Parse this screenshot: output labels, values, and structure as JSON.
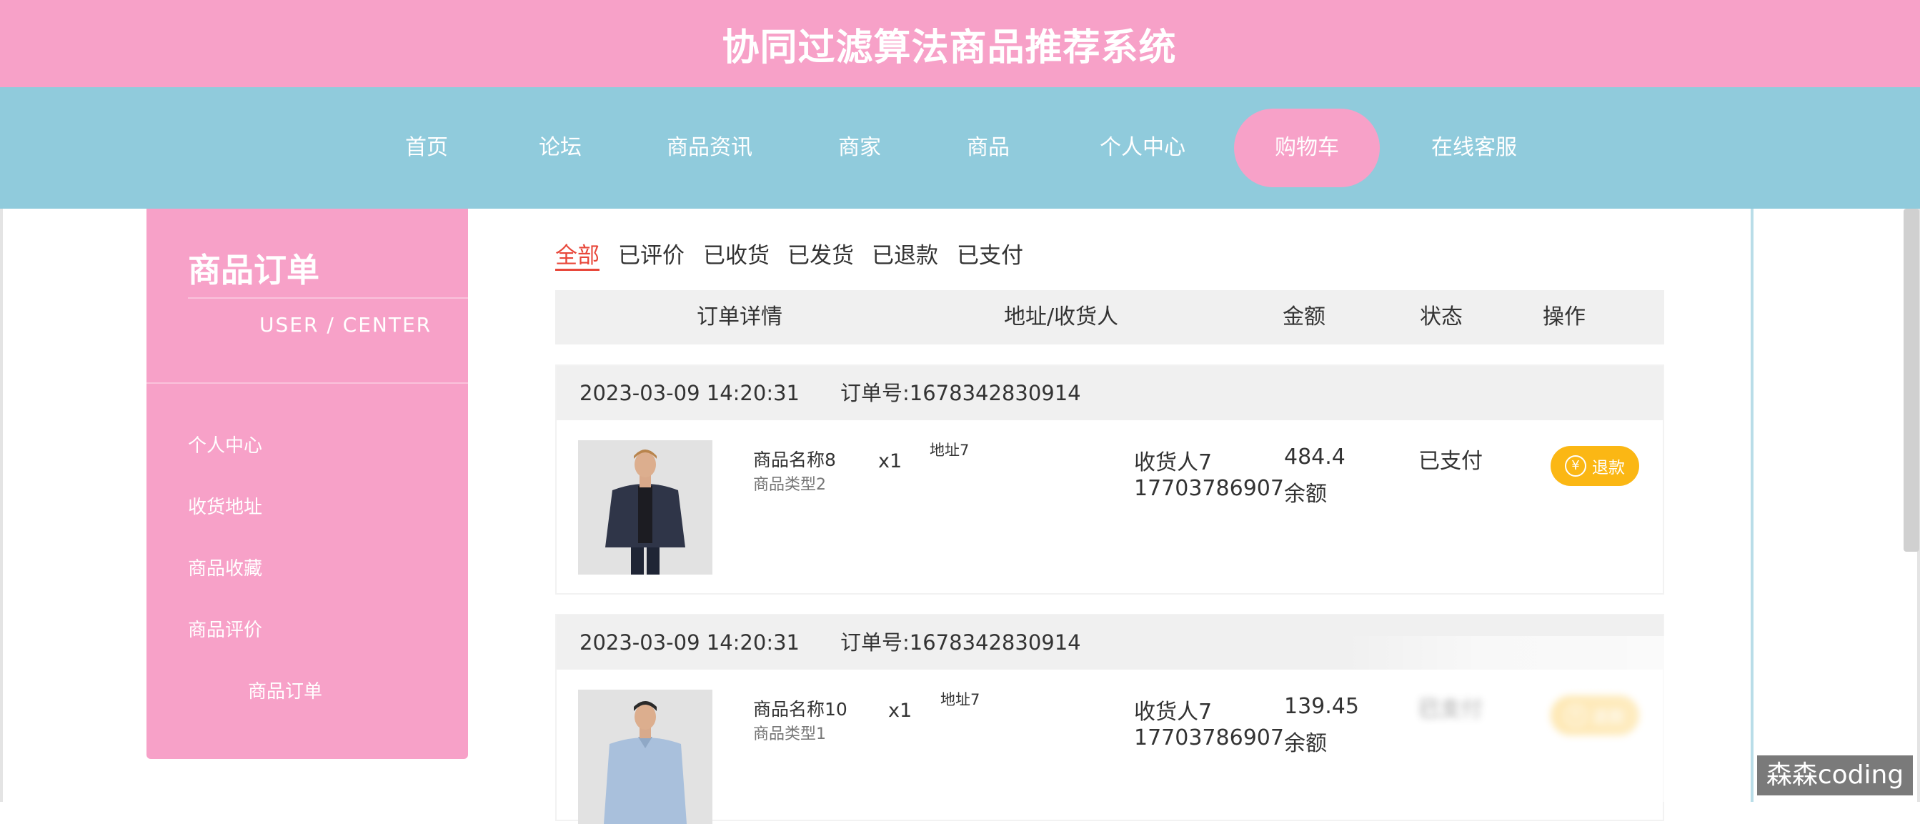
{
  "header": {
    "title": "协同过滤算法商品推荐系统"
  },
  "nav": {
    "items": [
      {
        "label": "首页"
      },
      {
        "label": "论坛"
      },
      {
        "label": "商品资讯"
      },
      {
        "label": "商家"
      },
      {
        "label": "商品"
      },
      {
        "label": "个人中心"
      },
      {
        "label": "购物车",
        "active": true
      },
      {
        "label": "在线客服"
      }
    ]
  },
  "sidebar": {
    "title": "商品订单",
    "subtitle": "USER / CENTER",
    "items": [
      {
        "label": "个人中心"
      },
      {
        "label": "收货地址"
      },
      {
        "label": "商品收藏"
      },
      {
        "label": "商品评价"
      },
      {
        "label": "商品订单",
        "active": true
      }
    ]
  },
  "tabs": {
    "items": [
      {
        "label": "全部",
        "active": true
      },
      {
        "label": "已评价"
      },
      {
        "label": "已收货"
      },
      {
        "label": "已发货"
      },
      {
        "label": "已退款"
      },
      {
        "label": "已支付"
      }
    ]
  },
  "table": {
    "headers": [
      "订单详情",
      "地址/收货人",
      "金额",
      "状态",
      "操作"
    ]
  },
  "orders": [
    {
      "time": "2023-03-09 14:20:31",
      "order_no": "订单号:1678342830914",
      "product_name": "商品名称8",
      "product_type": "商品类型2",
      "quantity": "x1",
      "address": "地址7",
      "receiver": "收货人7",
      "phone": "17703786907",
      "amount": "484.4",
      "pay_method": "余额",
      "status": "已支付",
      "action_icon": "¥",
      "action_label": "退款"
    },
    {
      "time": "2023-03-09 14:20:31",
      "order_no": "订单号:1678342830914",
      "product_name": "商品名称10",
      "product_type": "商品类型1",
      "quantity": "x1",
      "address": "地址7",
      "receiver": "收货人7",
      "phone": "17703786907",
      "amount": "139.45",
      "pay_method": "余额",
      "status": "已支付",
      "action_icon": "¥",
      "action_label": "退款"
    }
  ],
  "watermark": {
    "text": "森森coding"
  },
  "colors": {
    "header_bg": "#f7a1c8",
    "nav_bg": "#90cbdc",
    "active_tab": "#e8473a",
    "refund_button": "#fbb714",
    "table_header_bg": "#f0f0f0"
  }
}
